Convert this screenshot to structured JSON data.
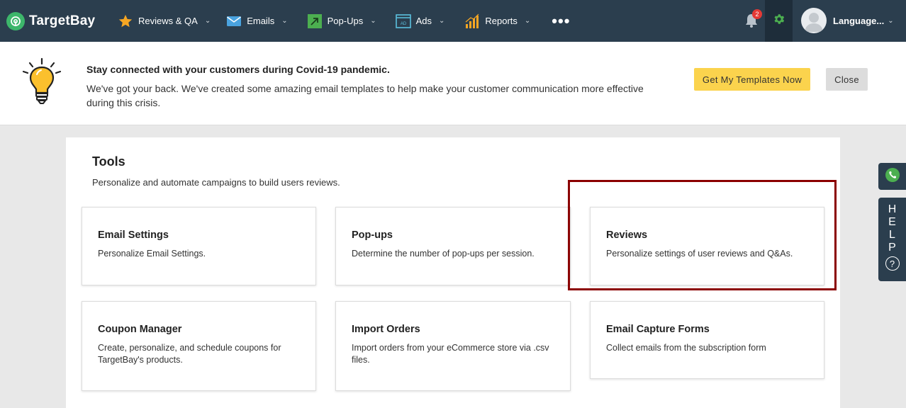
{
  "nav": {
    "brand": "TargetBay",
    "items": [
      {
        "label": "Reviews & QA",
        "icon": "star-icon"
      },
      {
        "label": "Emails",
        "icon": "envelope-icon"
      },
      {
        "label": "Pop-Ups",
        "icon": "popup-arrow-icon"
      },
      {
        "label": "Ads",
        "icon": "ad-icon"
      },
      {
        "label": "Reports",
        "icon": "bar-chart-icon"
      }
    ],
    "more": "•••",
    "notification_count": "2",
    "user_label": "Language...",
    "chevron": "⌄"
  },
  "banner": {
    "title": "Stay connected with your customers during Covid-19 pandemic.",
    "text": "We've got your back. We've created some amazing email templates to help make your customer communication more effective during this crisis.",
    "cta_label": "Get My Templates Now",
    "close_label": "Close"
  },
  "tools": {
    "title": "Tools",
    "subtitle": "Personalize and automate campaigns to build users reviews.",
    "cards": [
      {
        "title": "Email Settings",
        "desc": "Personalize Email Settings."
      },
      {
        "title": "Pop-ups",
        "desc": "Determine the number of pop-ups per session."
      },
      {
        "title": "Reviews",
        "desc": "Personalize settings of user reviews and Q&As."
      },
      {
        "title": "Coupon Manager",
        "desc": "Create, personalize, and schedule coupons for TargetBay's products."
      },
      {
        "title": "Import Orders",
        "desc": "Import orders from your eCommerce store via .csv files."
      },
      {
        "title": "Email Capture Forms",
        "desc": "Collect emails from the subscription form"
      }
    ]
  },
  "help": {
    "letters": [
      "H",
      "E",
      "L",
      "P"
    ],
    "question": "?"
  },
  "colors": {
    "nav_bg": "#2b3e4e",
    "brand_green": "#3db66b",
    "cta_yellow": "#fbd34d",
    "highlight": "#8b0000"
  }
}
